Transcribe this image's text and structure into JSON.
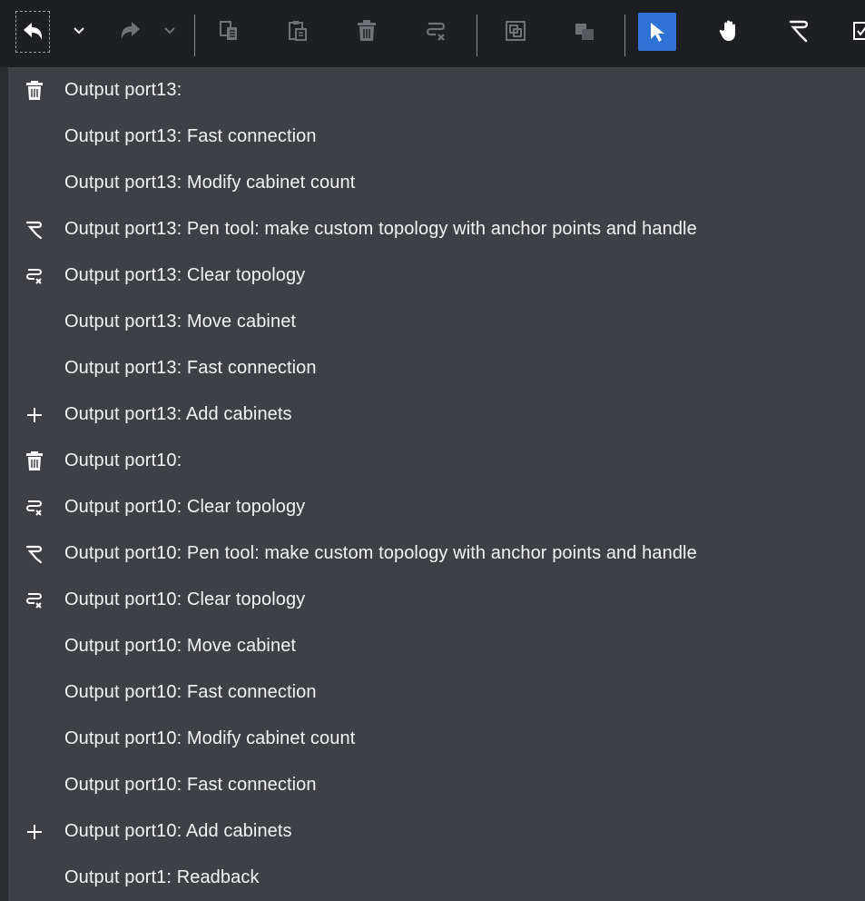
{
  "toolbar": {
    "buttons": [
      {
        "name": "undo-button",
        "icon": "undo-icon"
      },
      {
        "name": "undo-dropdown",
        "icon": "chevron-down-icon"
      },
      {
        "name": "redo-button",
        "icon": "redo-icon"
      },
      {
        "name": "redo-dropdown",
        "icon": "chevron-down-icon"
      },
      {
        "name": "copy-button",
        "icon": "copy-icon"
      },
      {
        "name": "paste-button",
        "icon": "paste-icon"
      },
      {
        "name": "delete-button",
        "icon": "trash-icon"
      },
      {
        "name": "clear-topology-button",
        "icon": "clear-topology-icon"
      },
      {
        "name": "group-button",
        "icon": "group-icon"
      },
      {
        "name": "layer-button",
        "icon": "layer-icon"
      },
      {
        "name": "select-tool-button",
        "icon": "pointer-icon",
        "active": true
      },
      {
        "name": "pan-tool-button",
        "icon": "hand-icon"
      },
      {
        "name": "pen-tool-button",
        "icon": "pen-icon"
      },
      {
        "name": "more-button",
        "icon": "checkbox-icon"
      }
    ],
    "accent_color": "#2f73d6"
  },
  "history": [
    {
      "label": "Output port13:",
      "icon": "trash-icon"
    },
    {
      "label": "Output port13: Fast connection",
      "icon": ""
    },
    {
      "label": "Output port13: Modify cabinet count",
      "icon": ""
    },
    {
      "label": "Output port13: Pen tool: make custom topology with anchor points and handle",
      "icon": "pen-icon"
    },
    {
      "label": "Output port13: Clear topology",
      "icon": "clear-topology-icon"
    },
    {
      "label": "Output port13: Move cabinet",
      "icon": ""
    },
    {
      "label": "Output port13: Fast connection",
      "icon": ""
    },
    {
      "label": "Output port13: Add cabinets",
      "icon": "plus-icon"
    },
    {
      "label": "Output port10:",
      "icon": "trash-icon"
    },
    {
      "label": "Output port10: Clear topology",
      "icon": "clear-topology-icon"
    },
    {
      "label": "Output port10: Pen tool: make custom topology with anchor points and handle",
      "icon": "pen-icon"
    },
    {
      "label": "Output port10: Clear topology",
      "icon": "clear-topology-icon"
    },
    {
      "label": "Output port10: Move cabinet",
      "icon": ""
    },
    {
      "label": "Output port10: Fast connection",
      "icon": ""
    },
    {
      "label": "Output port10: Modify cabinet count",
      "icon": ""
    },
    {
      "label": "Output port10: Fast connection",
      "icon": ""
    },
    {
      "label": "Output port10: Add cabinets",
      "icon": "plus-icon"
    },
    {
      "label": "Output port1: Readback",
      "icon": ""
    }
  ]
}
